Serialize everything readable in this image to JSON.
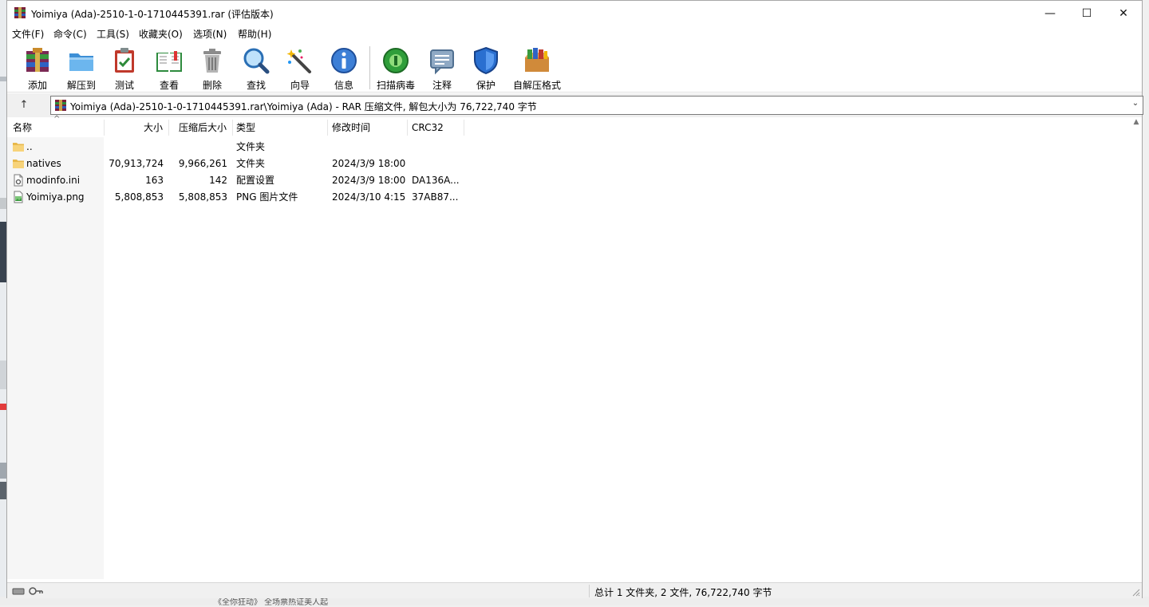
{
  "window": {
    "title": "Yoimiya (Ada)-2510-1-0-1710445391.rar (评估版本)",
    "minimize_glyph": "—",
    "maximize_glyph": "☐",
    "close_glyph": "✕"
  },
  "menu": {
    "items": [
      "文件(F)",
      "命令(C)",
      "工具(S)",
      "收藏夹(O)",
      "选项(N)",
      "帮助(H)"
    ]
  },
  "toolbar": {
    "buttons": [
      {
        "label": "添加",
        "icon": "add-archive-icon"
      },
      {
        "label": "解压到",
        "icon": "extract-folder-icon"
      },
      {
        "label": "测试",
        "icon": "test-clipboard-icon"
      },
      {
        "label": "查看",
        "icon": "view-book-icon"
      },
      {
        "label": "删除",
        "icon": "trash-icon"
      },
      {
        "label": "查找",
        "icon": "magnifier-icon"
      },
      {
        "label": "向导",
        "icon": "wizard-wand-icon"
      },
      {
        "label": "信息",
        "icon": "info-icon"
      },
      {
        "label": "扫描病毒",
        "icon": "virus-scan-icon"
      },
      {
        "label": "注释",
        "icon": "comment-icon"
      },
      {
        "label": "保护",
        "icon": "shield-icon"
      },
      {
        "label": "自解压格式",
        "icon": "sfx-box-icon"
      }
    ]
  },
  "address": {
    "up_glyph": "↑",
    "path": "Yoimiya (Ada)-2510-1-0-1710445391.rar\\Yoimiya (Ada) - RAR 压缩文件, 解包大小为 76,722,740 字节"
  },
  "columns": {
    "name": "名称",
    "size": "大小",
    "packed": "压缩后大小",
    "type": "类型",
    "modified": "修改时间",
    "crc": "CRC32"
  },
  "files": [
    {
      "name": "..",
      "size": "",
      "packed": "",
      "type": "文件夹",
      "modified": "",
      "crc": "",
      "icon": "folder-icon"
    },
    {
      "name": "natives",
      "size": "70,913,724",
      "packed": "9,966,261",
      "type": "文件夹",
      "modified": "2024/3/9 18:00",
      "crc": "",
      "icon": "folder-icon"
    },
    {
      "name": "modinfo.ini",
      "size": "163",
      "packed": "142",
      "type": "配置设置",
      "modified": "2024/3/9 18:00",
      "crc": "DA136A...",
      "icon": "ini-file-icon"
    },
    {
      "name": "Yoimiya.png",
      "size": "5,808,853",
      "packed": "5,808,853",
      "type": "PNG 图片文件",
      "modified": "2024/3/10 4:15",
      "crc": "37AB87...",
      "icon": "png-file-icon"
    }
  ],
  "status": {
    "summary": "总计 1 文件夹, 2 文件, 76,722,740 字节"
  },
  "background": {
    "peek_text": "《全你狂动》 全场票热证美人起"
  }
}
